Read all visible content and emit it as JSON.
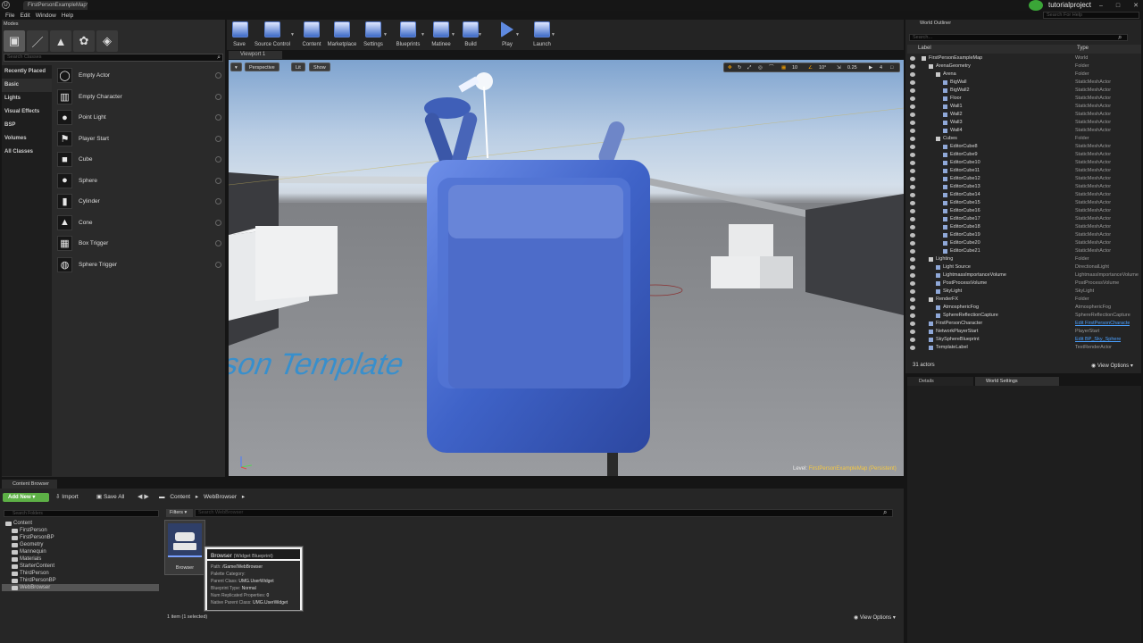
{
  "window": {
    "map_tab": "FirstPersonExampleMap*",
    "project_name": "tutorialproject",
    "help_search_placeholder": "Search For Help",
    "controls": [
      "–",
      "□",
      "✕"
    ]
  },
  "menu": [
    "File",
    "Edit",
    "Window",
    "Help"
  ],
  "modes": {
    "tab_label": "Modes",
    "search_placeholder": "Search Classes",
    "categories": [
      "Recently Placed",
      "Basic",
      "Lights",
      "Visual Effects",
      "BSP",
      "Volumes",
      "All Classes"
    ],
    "items": [
      {
        "label": "Empty Actor",
        "icon": "cylinder-icon"
      },
      {
        "label": "Empty Character",
        "icon": "character-icon"
      },
      {
        "label": "Point Light",
        "icon": "light-bulb-icon"
      },
      {
        "label": "Player Start",
        "icon": "player-start-icon"
      },
      {
        "label": "Cube",
        "icon": "cube-icon"
      },
      {
        "label": "Sphere",
        "icon": "sphere-icon"
      },
      {
        "label": "Cylinder",
        "icon": "cylinder-icon"
      },
      {
        "label": "Cone",
        "icon": "cone-icon"
      },
      {
        "label": "Box Trigger",
        "icon": "box-trigger-icon"
      },
      {
        "label": "Sphere Trigger",
        "icon": "sphere-trigger-icon"
      }
    ]
  },
  "toolbar": {
    "buttons": [
      {
        "label": "Save"
      },
      {
        "label": "Source Control"
      },
      {
        "label": "Content"
      },
      {
        "label": "Marketplace"
      },
      {
        "label": "Settings"
      },
      {
        "label": "Blueprints"
      },
      {
        "label": "Matinee"
      },
      {
        "label": "Build"
      },
      {
        "label": "Play"
      },
      {
        "label": "Launch"
      }
    ]
  },
  "viewport": {
    "tab_label": "Viewport 1",
    "perspective": "Perspective",
    "lit": "Lit",
    "show": "Show",
    "grid_snap": "10",
    "rotation_snap": "10°",
    "scale_snap": "0.25",
    "camera_speed": "4",
    "level_label": "Level:",
    "level_name": "FirstPersonExampleMap (Persistent)",
    "floor_text": "First Person Template"
  },
  "outliner": {
    "tab_label": "World Outliner",
    "search_placeholder": "Search...",
    "col_label": "Label",
    "col_type": "Type",
    "rows": [
      {
        "label": "FirstPersonExampleMap",
        "type": "World",
        "indent": 0
      },
      {
        "label": "ArenaGeometry",
        "type": "Folder",
        "indent": 1
      },
      {
        "label": "Arena",
        "type": "Folder",
        "indent": 2
      },
      {
        "label": "BigWall",
        "type": "StaticMeshActor",
        "indent": 3
      },
      {
        "label": "BigWall2",
        "type": "StaticMeshActor",
        "indent": 3
      },
      {
        "label": "Floor",
        "type": "StaticMeshActor",
        "indent": 3
      },
      {
        "label": "Wall1",
        "type": "StaticMeshActor",
        "indent": 3
      },
      {
        "label": "Wall2",
        "type": "StaticMeshActor",
        "indent": 3
      },
      {
        "label": "Wall3",
        "type": "StaticMeshActor",
        "indent": 3
      },
      {
        "label": "Wall4",
        "type": "StaticMeshActor",
        "indent": 3
      },
      {
        "label": "Cubes",
        "type": "Folder",
        "indent": 2
      },
      {
        "label": "EditorCube8",
        "type": "StaticMeshActor",
        "indent": 3
      },
      {
        "label": "EditorCube9",
        "type": "StaticMeshActor",
        "indent": 3
      },
      {
        "label": "EditorCube10",
        "type": "StaticMeshActor",
        "indent": 3
      },
      {
        "label": "EditorCube11",
        "type": "StaticMeshActor",
        "indent": 3
      },
      {
        "label": "EditorCube12",
        "type": "StaticMeshActor",
        "indent": 3
      },
      {
        "label": "EditorCube13",
        "type": "StaticMeshActor",
        "indent": 3
      },
      {
        "label": "EditorCube14",
        "type": "StaticMeshActor",
        "indent": 3
      },
      {
        "label": "EditorCube15",
        "type": "StaticMeshActor",
        "indent": 3
      },
      {
        "label": "EditorCube16",
        "type": "StaticMeshActor",
        "indent": 3
      },
      {
        "label": "EditorCube17",
        "type": "StaticMeshActor",
        "indent": 3
      },
      {
        "label": "EditorCube18",
        "type": "StaticMeshActor",
        "indent": 3
      },
      {
        "label": "EditorCube19",
        "type": "StaticMeshActor",
        "indent": 3
      },
      {
        "label": "EditorCube20",
        "type": "StaticMeshActor",
        "indent": 3
      },
      {
        "label": "EditorCube21",
        "type": "StaticMeshActor",
        "indent": 3
      },
      {
        "label": "Lighting",
        "type": "Folder",
        "indent": 1
      },
      {
        "label": "Light Source",
        "type": "DirectionalLight",
        "indent": 2
      },
      {
        "label": "LightmassImportanceVolume",
        "type": "LightmassImportanceVolume",
        "indent": 2
      },
      {
        "label": "PostProcessVolume",
        "type": "PostProcessVolume",
        "indent": 2
      },
      {
        "label": "SkyLight",
        "type": "SkyLight",
        "indent": 2
      },
      {
        "label": "RenderFX",
        "type": "Folder",
        "indent": 1
      },
      {
        "label": "AtmosphericFog",
        "type": "AtmosphericFog",
        "indent": 2
      },
      {
        "label": "SphereReflectionCapture",
        "type": "SphereReflectionCapture",
        "indent": 2
      },
      {
        "label": "FirstPersonCharacter",
        "type": "Edit FirstPersonCharacte",
        "indent": 1,
        "link": true
      },
      {
        "label": "NetworkPlayerStart",
        "type": "PlayerStart",
        "indent": 1
      },
      {
        "label": "SkySphereBlueprint",
        "type": "Edit BP_Sky_Sphere",
        "indent": 1,
        "link": true
      },
      {
        "label": "TemplateLabel",
        "type": "TextRenderActor",
        "indent": 1
      }
    ],
    "actors_count": "31 actors",
    "view_options": "View Options"
  },
  "details": {
    "details_tab": "Details",
    "world_settings_tab": "World Settings"
  },
  "content_browser": {
    "tab_label": "Content Browser",
    "add_new": "Add New",
    "import": "Import",
    "save_all": "Save All",
    "crumbs": [
      "Content",
      "WebBrowser"
    ],
    "folder_search_placeholder": "Search Folders",
    "filters": "Filters",
    "asset_search_placeholder": "Search WebBrowser",
    "folders": [
      {
        "label": "Content",
        "indent": 0
      },
      {
        "label": "FirstPerson",
        "indent": 1
      },
      {
        "label": "FirstPersonBP",
        "indent": 1
      },
      {
        "label": "Geometry",
        "indent": 1
      },
      {
        "label": "Mannequin",
        "indent": 1
      },
      {
        "label": "Materials",
        "indent": 1
      },
      {
        "label": "StarterContent",
        "indent": 1
      },
      {
        "label": "ThirdPerson",
        "indent": 1
      },
      {
        "label": "ThirdPersonBP",
        "indent": 1
      },
      {
        "label": "WebBrowser",
        "indent": 1,
        "selected": true
      }
    ],
    "asset": {
      "label": "Browser",
      "tooltip_name": "Browser",
      "tooltip_kind": "(Widget Blueprint)",
      "path_label": "Path:",
      "path": "/Game/WebBrowser",
      "palette_label": "Palette Category:",
      "palette": "",
      "parent_label": "Parent Class:",
      "parent": "UMG.UserWidget",
      "bptype_label": "Blueprint Type:",
      "bptype": "Normal",
      "numrep_label": "Num Replicated Properties:",
      "numrep": "0",
      "native_label": "Native Parent Class:",
      "native": "UMG.UserWidget"
    },
    "items_count": "1 item (1 selected)",
    "view_options": "View Options"
  },
  "colors": {
    "accent_green": "#5db046",
    "link_blue": "#4aa0ff",
    "selection_yellow": "#f5c842",
    "cube_blue": "#3f63c8"
  }
}
